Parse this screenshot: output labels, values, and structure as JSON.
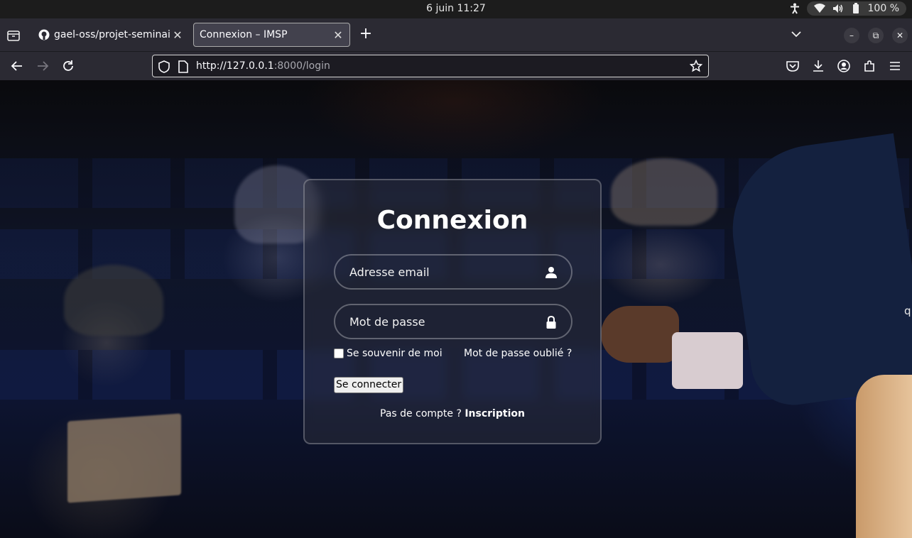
{
  "system": {
    "datetime": "6 juin  11:27",
    "battery": "100 %"
  },
  "browser": {
    "tabs": [
      {
        "title": "gael-oss/projet-seminaire",
        "icon": "github-icon",
        "active": false
      },
      {
        "title": "Connexion – IMSP",
        "icon": "",
        "active": true
      }
    ],
    "url_host": "http://127.0.0.1",
    "url_rest": ":8000/login"
  },
  "login": {
    "title": "Connexion",
    "email_placeholder": "Adresse email",
    "password_placeholder": "Mot de passe",
    "remember_label": "Se souvenir de moi",
    "forgot_label": "Mot de passe oublié ?",
    "submit_label": "Se connecter",
    "no_account_text": "Pas de compte ?",
    "signup_label": "Inscription"
  },
  "page_edge_text": "q"
}
